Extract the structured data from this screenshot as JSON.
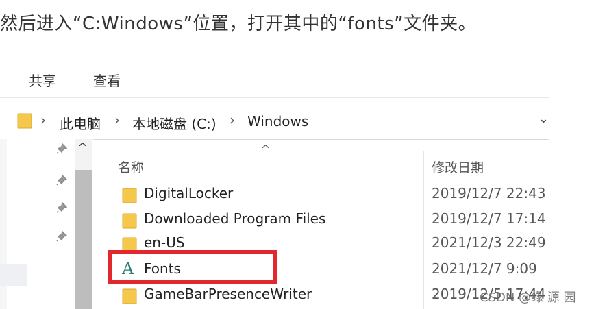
{
  "caption": "然后进入“C:Windows”位置，打开其中的“fonts”文件夹。",
  "ribbon": {
    "tabs": [
      "共享",
      "查看"
    ]
  },
  "address_bar": {
    "crumbs": [
      "此电脑",
      "本地磁盘 (C:)",
      "Windows"
    ],
    "separator": "›",
    "dropdown_glyph": "⌄",
    "folder_icon": "folder-icon"
  },
  "nav": {
    "scroll_up_glyph": "^",
    "pin_glyph": "📌"
  },
  "list": {
    "sort_glyph": "^",
    "columns": {
      "name": "名称",
      "date": "修改日期"
    },
    "rows": [
      {
        "name": "DigitalLocker",
        "date": "2019/12/7 22:43",
        "icon": "folder-icon"
      },
      {
        "name": "Downloaded Program Files",
        "date": "2019/12/7 17:14",
        "icon": "folder-icon"
      },
      {
        "name": "en-US",
        "date": "2021/12/3 22:49",
        "icon": "folder-icon"
      },
      {
        "name": "Fonts",
        "date": "2021/12/7 9:09",
        "icon": "fonts-folder-icon",
        "icon_glyph": "A"
      },
      {
        "name": "GameBarPresenceWriter",
        "date": "2019/12/5 17:44",
        "icon": "folder-icon"
      }
    ]
  },
  "watermark": "CSDN @缘  源  园",
  "colors": {
    "highlight": "#e0282e",
    "folder": "#f5c84c",
    "fonts_glyph": "#2e7d74"
  }
}
